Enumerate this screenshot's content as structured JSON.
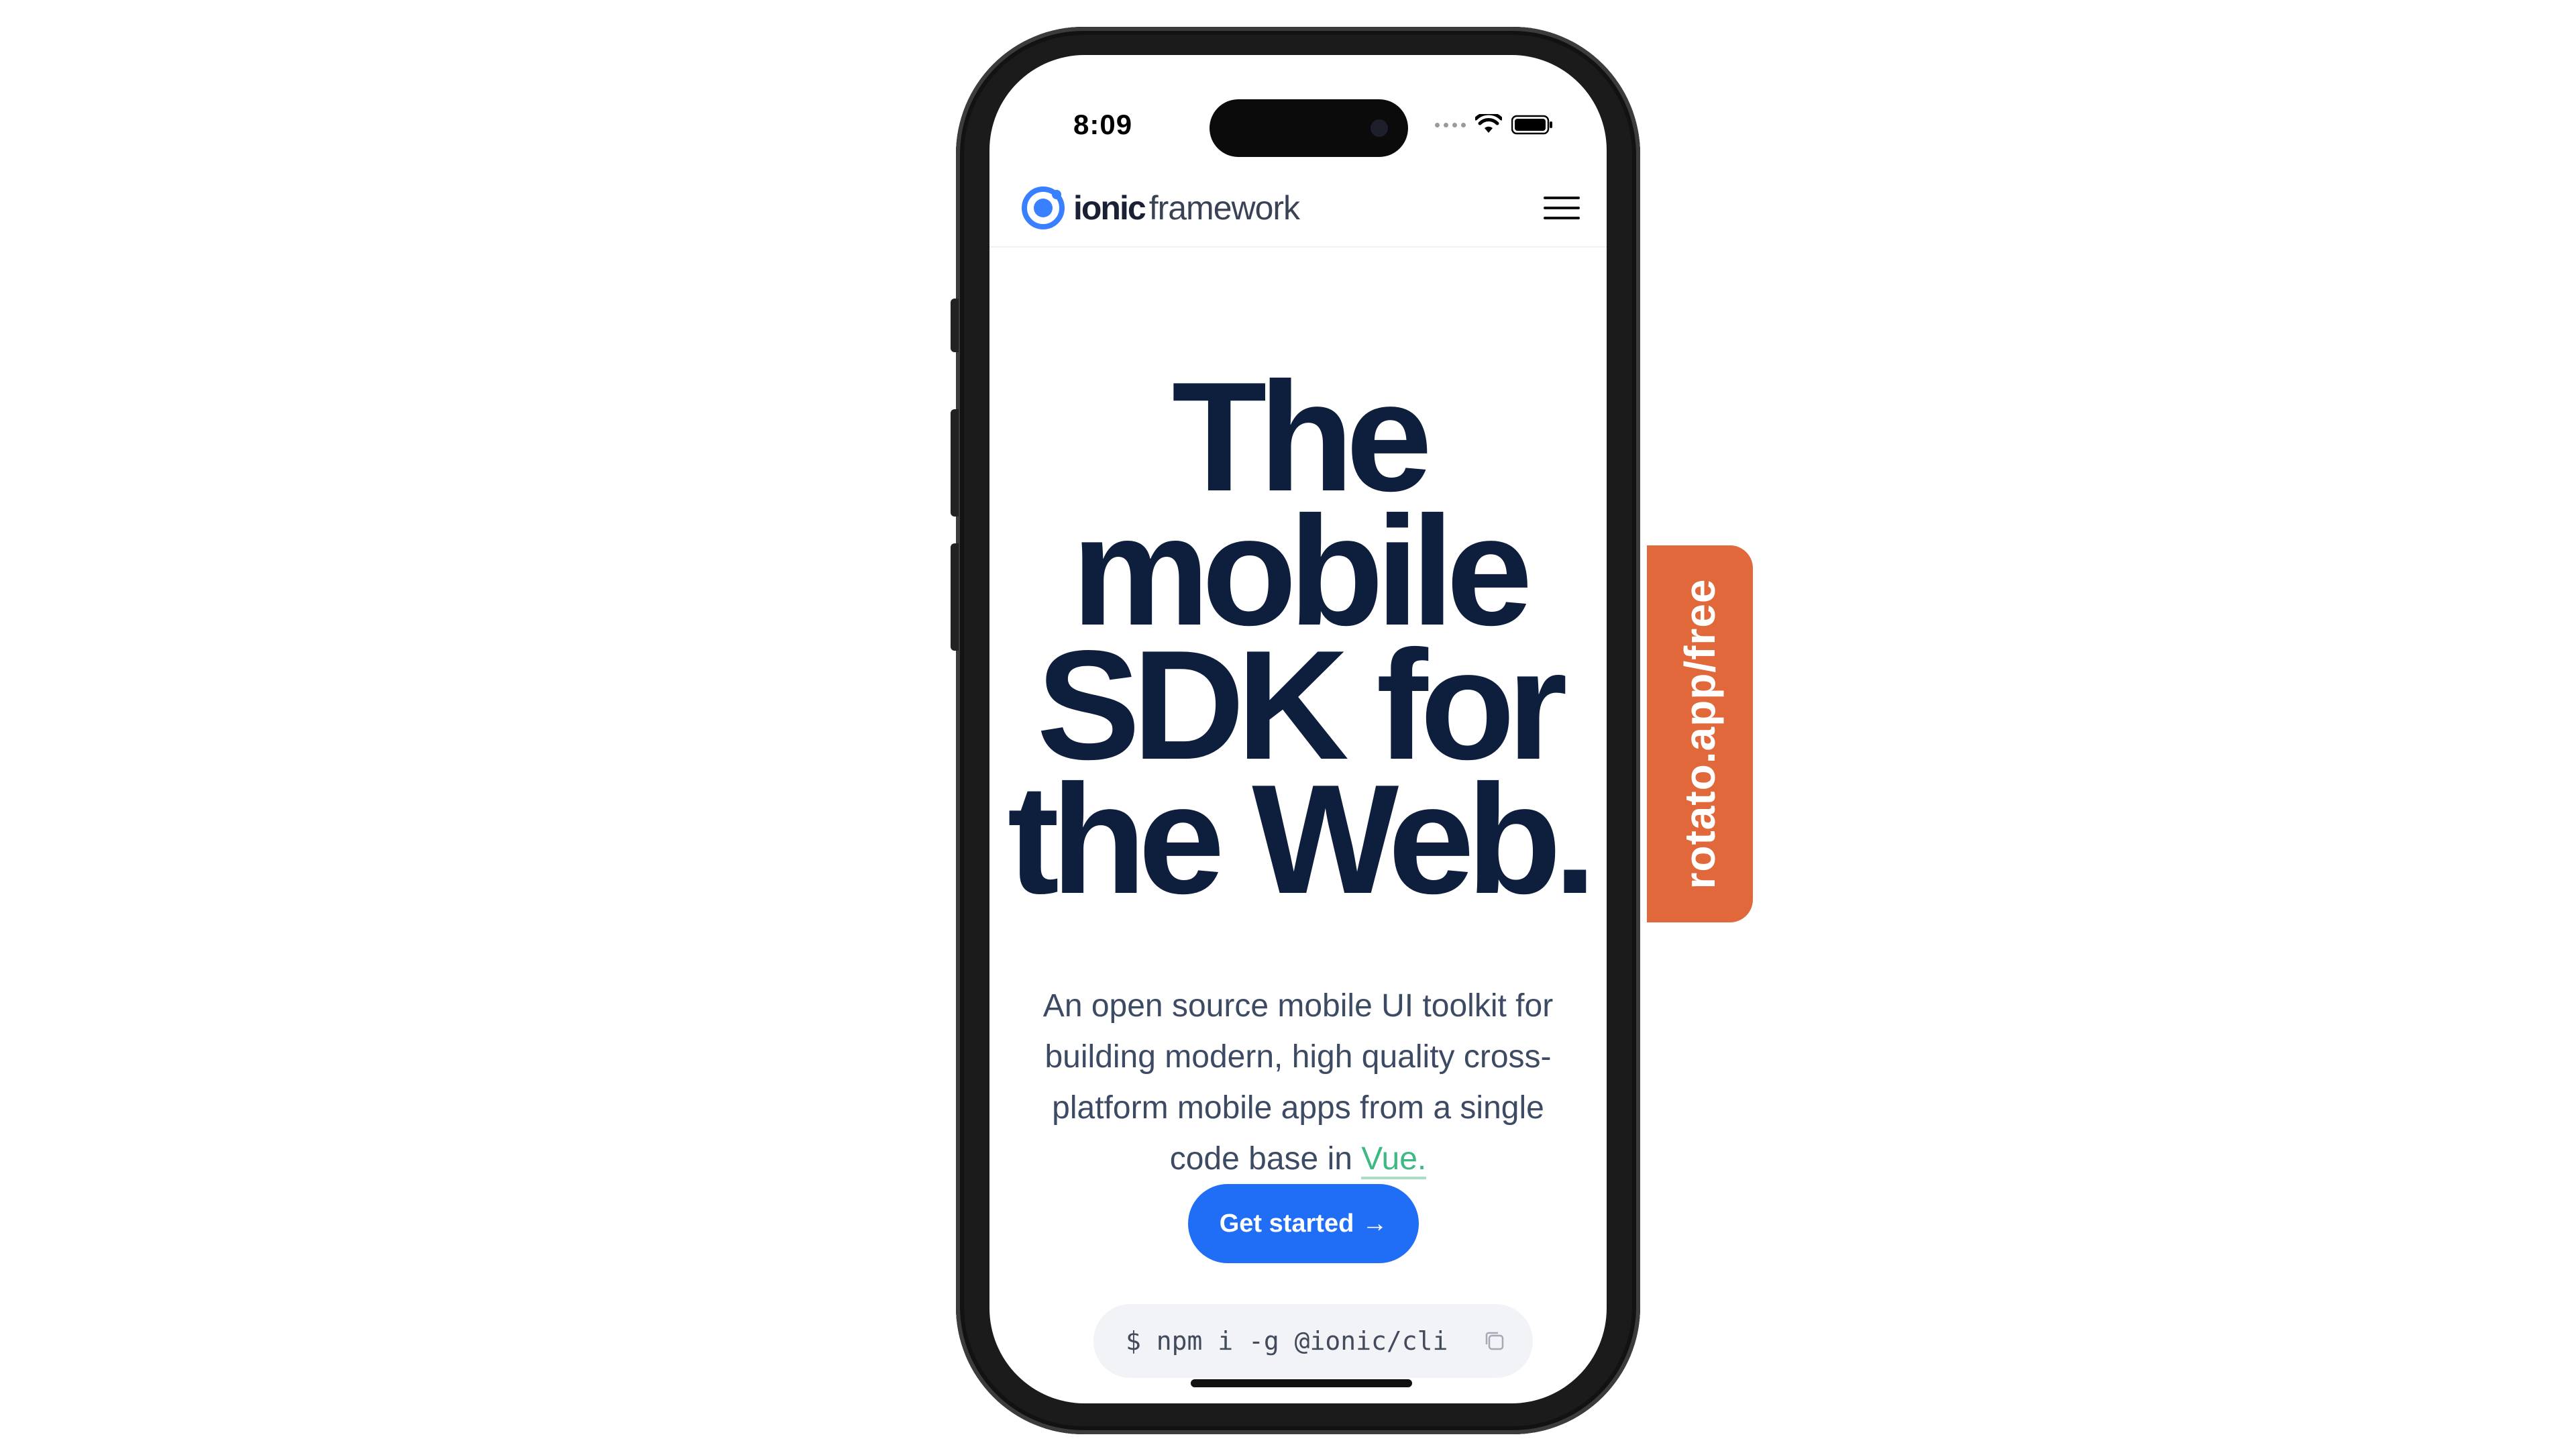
{
  "status_bar": {
    "time": "8:09"
  },
  "nav": {
    "logo_bold": "ionic",
    "logo_light": "framework"
  },
  "hero": {
    "title_lines": [
      "The",
      "mobile",
      "SDK for",
      "the Web."
    ],
    "subtitle_lines": [
      "An open source mobile UI toolkit for",
      "building modern, high quality cross-",
      "platform mobile apps from a single"
    ],
    "subtitle_last_prefix": "code base in ",
    "subtitle_link": "Vue.",
    "cta_label": "Get started",
    "cta_arrow": "→",
    "cli_command": "$ npm i -g @ionic/cli"
  },
  "promo": {
    "text": "rotato.app/free"
  },
  "colors": {
    "heading": "#0e1e3d",
    "primary": "#1f6ef5",
    "vue_green": "#3fb983",
    "promo": "#e0683a"
  },
  "icons": {
    "logo": "ionic-logo-icon",
    "menu": "hamburger-menu-icon",
    "copy": "copy-icon",
    "wifi": "wifi-icon",
    "battery": "battery-icon",
    "signal": "signal-dots-icon"
  }
}
